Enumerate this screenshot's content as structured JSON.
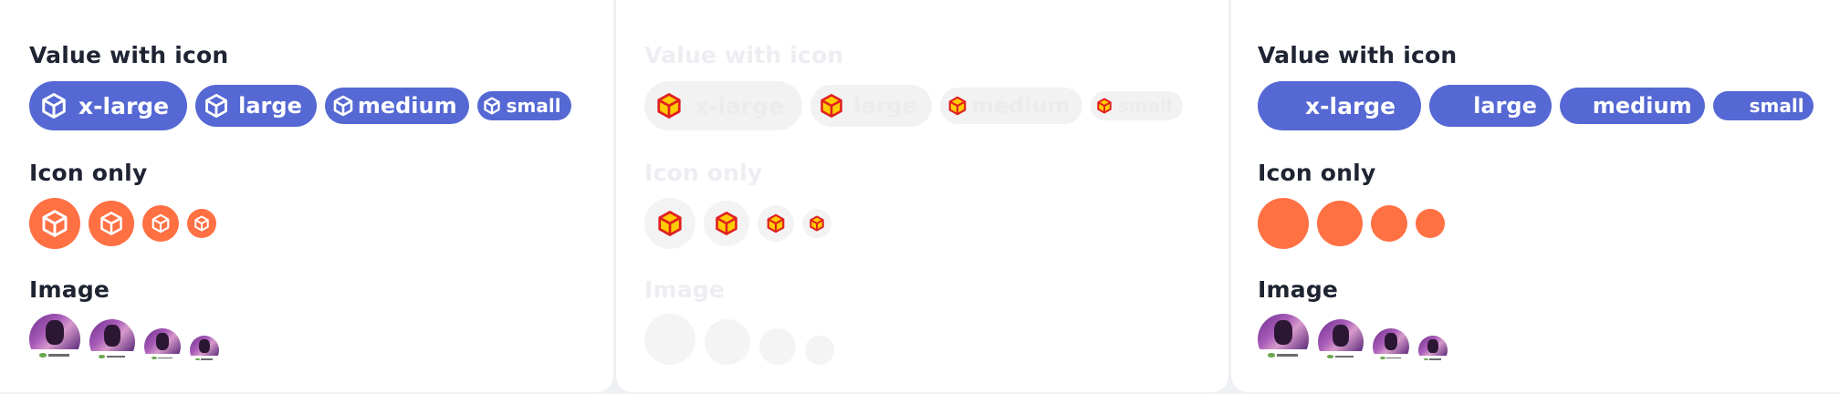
{
  "colors": {
    "chip_bg": "#5568d3",
    "dot_bg": "#ff7043",
    "title": "#1f2433",
    "muted_title": "#eceef2",
    "placeholder_icon_fill": "#ffcc00",
    "placeholder_icon_stroke": "#e02020"
  },
  "panels": [
    {
      "value_title": "Value with icon",
      "icon_only_title": "Icon only",
      "image_title": "Image",
      "chips": {
        "xl": "x-large",
        "lg": "large",
        "md": "medium",
        "sm": "small"
      },
      "icon": "cube-icon"
    },
    {
      "value_title": "Value with icon",
      "icon_only_title": "Icon only",
      "image_title": "Image",
      "chips": {
        "xl": "x-large",
        "lg": "large",
        "md": "medium",
        "sm": "small"
      },
      "icon": "cube-icon"
    },
    {
      "value_title": "Value with icon",
      "icon_only_title": "Icon only",
      "image_title": "Image",
      "chips": {
        "xl": "x-large",
        "lg": "large",
        "md": "medium",
        "sm": "small"
      },
      "icon": "none"
    }
  ]
}
